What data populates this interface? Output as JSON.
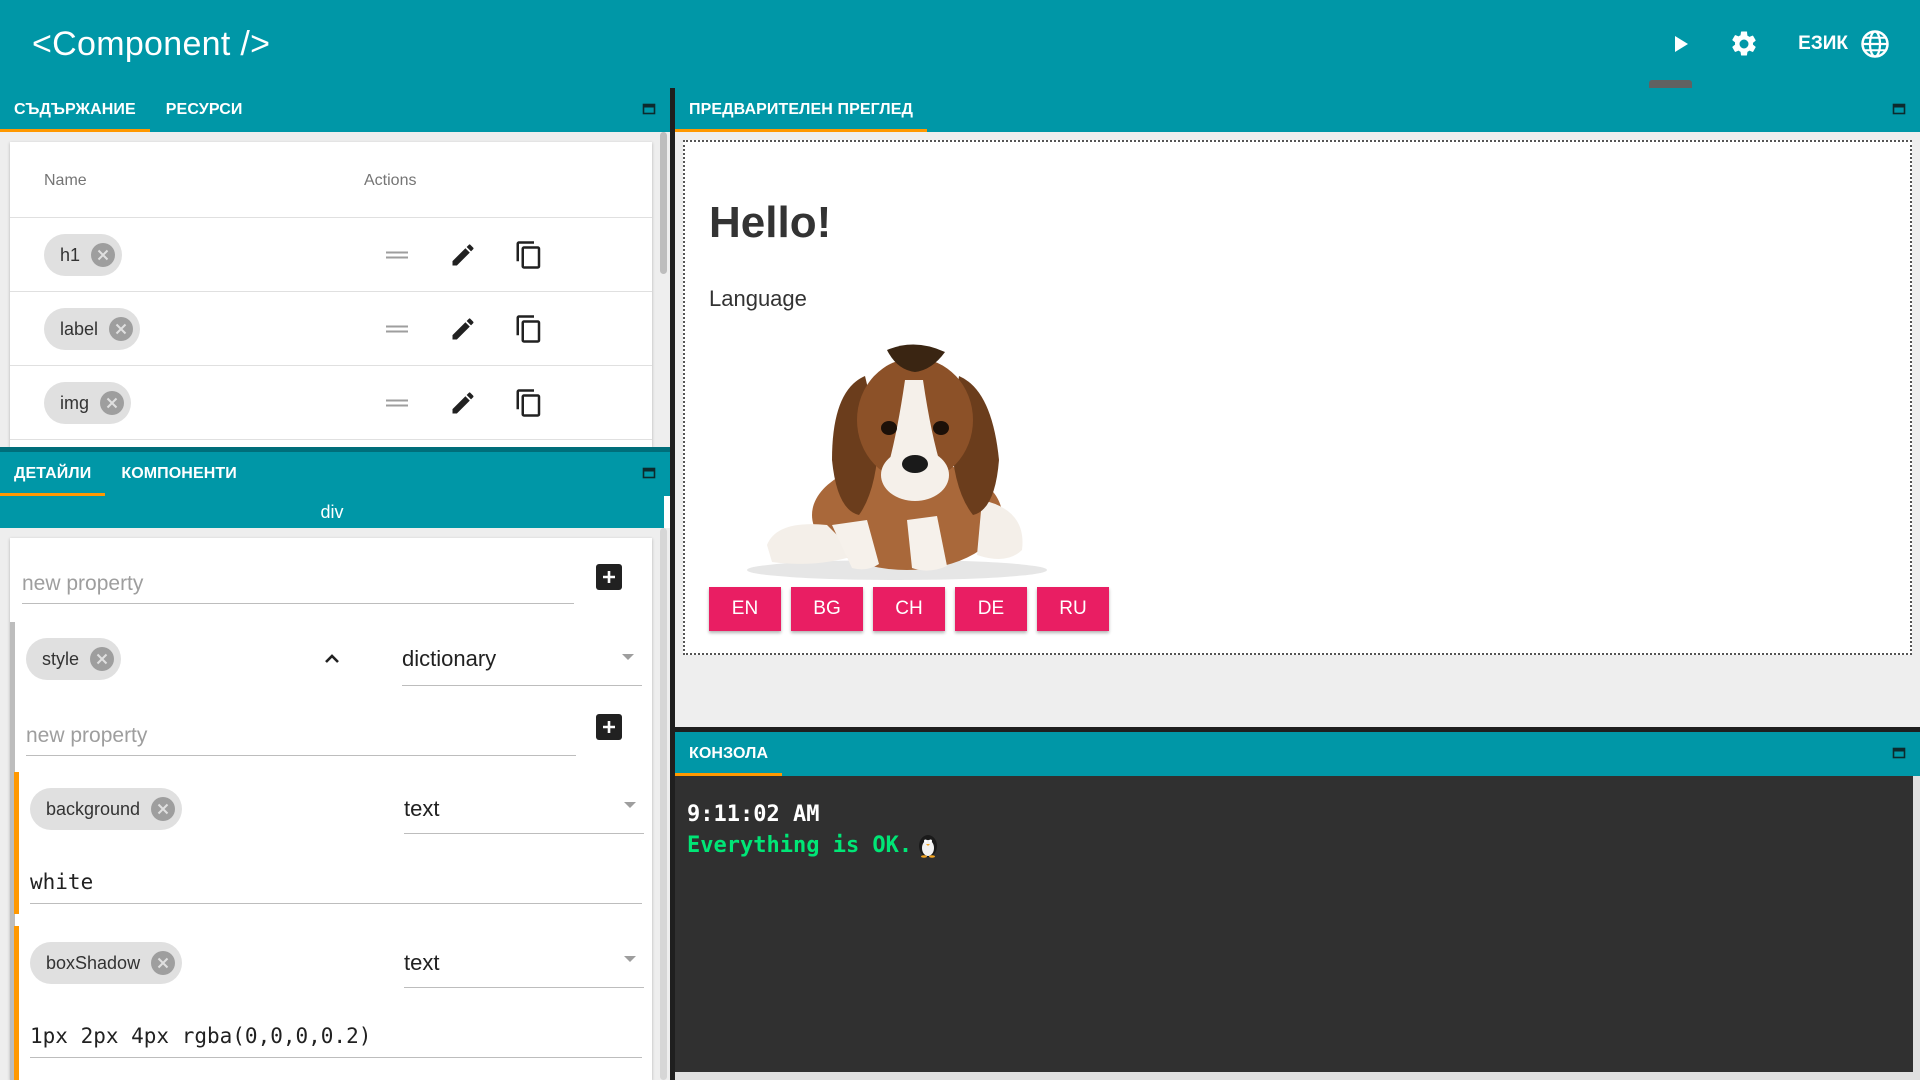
{
  "app": {
    "title": "<Component />",
    "language_label": "ЕЗИК",
    "play_tooltip": "Play",
    "icons": [
      "play-icon",
      "gear-icon",
      "globe-icon"
    ]
  },
  "content_panel": {
    "tabs": [
      {
        "label": "СЪДЪРЖАНИЕ",
        "active": true
      },
      {
        "label": "РЕСУРСИ",
        "active": false
      }
    ],
    "columns": [
      "Name",
      "Actions"
    ],
    "rows": [
      {
        "name": "h1"
      },
      {
        "name": "label"
      },
      {
        "name": "img"
      }
    ],
    "row_icons": [
      "drag-handle-icon",
      "edit-icon",
      "copy-icon"
    ]
  },
  "details_panel": {
    "tabs": [
      {
        "label": "ДЕТАЙЛИ",
        "active": true
      },
      {
        "label": "КОМПОНЕНТИ",
        "active": false
      }
    ],
    "element": "div",
    "new_property_placeholder": "new property",
    "style_prop": {
      "name": "style",
      "type": "dictionary"
    },
    "nested_placeholder": "new property",
    "properties": [
      {
        "name": "background",
        "type": "text",
        "value": "white"
      },
      {
        "name": "boxShadow",
        "type": "text",
        "value": "1px 2px 4px rgba(0,0,0,0.2)"
      }
    ]
  },
  "preview_panel": {
    "tab": "ПРЕДВАРИТЕЛЕН ПРЕГЛЕД",
    "heading": "Hello!",
    "label": "Language",
    "buttons": [
      "EN",
      "BG",
      "CH",
      "DE",
      "RU"
    ]
  },
  "console_panel": {
    "tab": "КОНЗОЛА",
    "time": "9:11:02 AM",
    "message": "Everything is OK."
  },
  "colors": {
    "primary": "#0097a7",
    "tab_indicator": "#ff9800",
    "accent_button": "#e91e63",
    "console_bg": "#303030",
    "console_ok": "#00e676"
  }
}
